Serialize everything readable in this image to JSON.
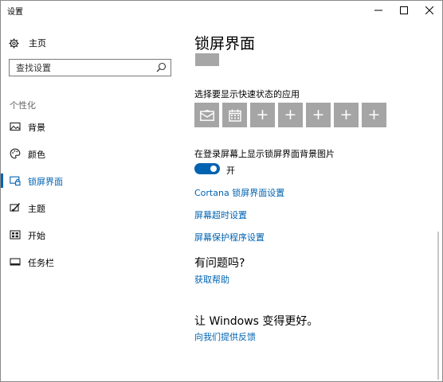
{
  "window": {
    "title": "设置"
  },
  "sidebar": {
    "home_label": "主页",
    "search_placeholder": "查找设置",
    "section_label": "个性化",
    "items": [
      {
        "label": "背景",
        "icon": "picture-icon"
      },
      {
        "label": "颜色",
        "icon": "palette-icon"
      },
      {
        "label": "锁屏界面",
        "icon": "lock-screen-icon",
        "selected": true
      },
      {
        "label": "主题",
        "icon": "brush-icon"
      },
      {
        "label": "开始",
        "icon": "start-grid-icon"
      },
      {
        "label": "任务栏",
        "icon": "taskbar-icon"
      }
    ]
  },
  "main": {
    "title": "锁屏界面",
    "quick_status_label": "选择要显示快速状态的应用",
    "quick_status_tiles": [
      {
        "icon": "mail-icon"
      },
      {
        "icon": "calendar-icon"
      },
      {
        "icon": "plus-icon",
        "text": "+"
      },
      {
        "icon": "plus-icon",
        "text": "+"
      },
      {
        "icon": "plus-icon",
        "text": "+"
      },
      {
        "icon": "plus-icon",
        "text": "+"
      },
      {
        "icon": "plus-icon",
        "text": "+"
      }
    ],
    "bg_on_signin_label": "在登录屏幕上显示锁屏界面背景图片",
    "toggle_state": "开",
    "toggle_on": true,
    "links": {
      "cortana": "Cortana 锁屏界面设置",
      "screen_timeout": "屏幕超时设置",
      "screensaver": "屏幕保护程序设置"
    },
    "help": {
      "title": "有问题吗?",
      "link": "获取帮助"
    },
    "improve": {
      "title": "让 Windows 变得更好。",
      "link": "向我们提供反馈"
    }
  },
  "colors": {
    "accent": "#0063b1",
    "tile": "#a5a5a5"
  }
}
